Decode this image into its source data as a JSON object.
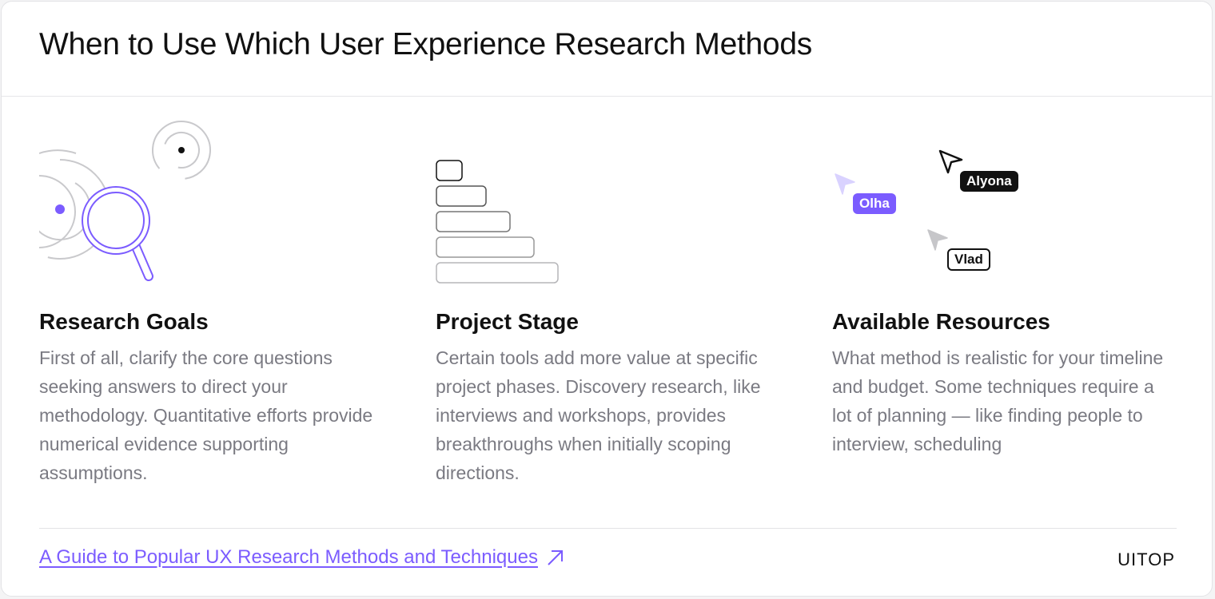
{
  "header": {
    "title": "When to Use Which User Experience Research Methods"
  },
  "columns": [
    {
      "heading": "Research Goals",
      "body": "First of all, clarify the core questions seeking answers to direct your methodology. Quantitative efforts provide numerical evidence supporting assumptions.",
      "icon": "magnifier-radar-icon"
    },
    {
      "heading": "Project Stage",
      "body": "Certain tools add more value at specific project phases. Discovery research, like interviews and workshops, provides breakthroughs when initially scoping directions.",
      "icon": "staircase-bars-icon"
    },
    {
      "heading": "Available Resources",
      "body": "What method is realistic for your timeline and budget. Some techniques require a lot of planning — like finding people to interview, scheduling",
      "icon": "cursors-icon",
      "cursors": [
        {
          "label": "Olha",
          "color": "#7b5cff"
        },
        {
          "label": "Alyona",
          "color": "#111111"
        },
        {
          "label": "Vlad",
          "color": "#ffffff"
        }
      ]
    }
  ],
  "footer": {
    "link_label": "A Guide to Popular UX Research Methods and Techniques",
    "brand": "UITOP"
  },
  "colors": {
    "accent": "#7b5cff",
    "text": "#111111",
    "muted": "#7a7a82"
  }
}
